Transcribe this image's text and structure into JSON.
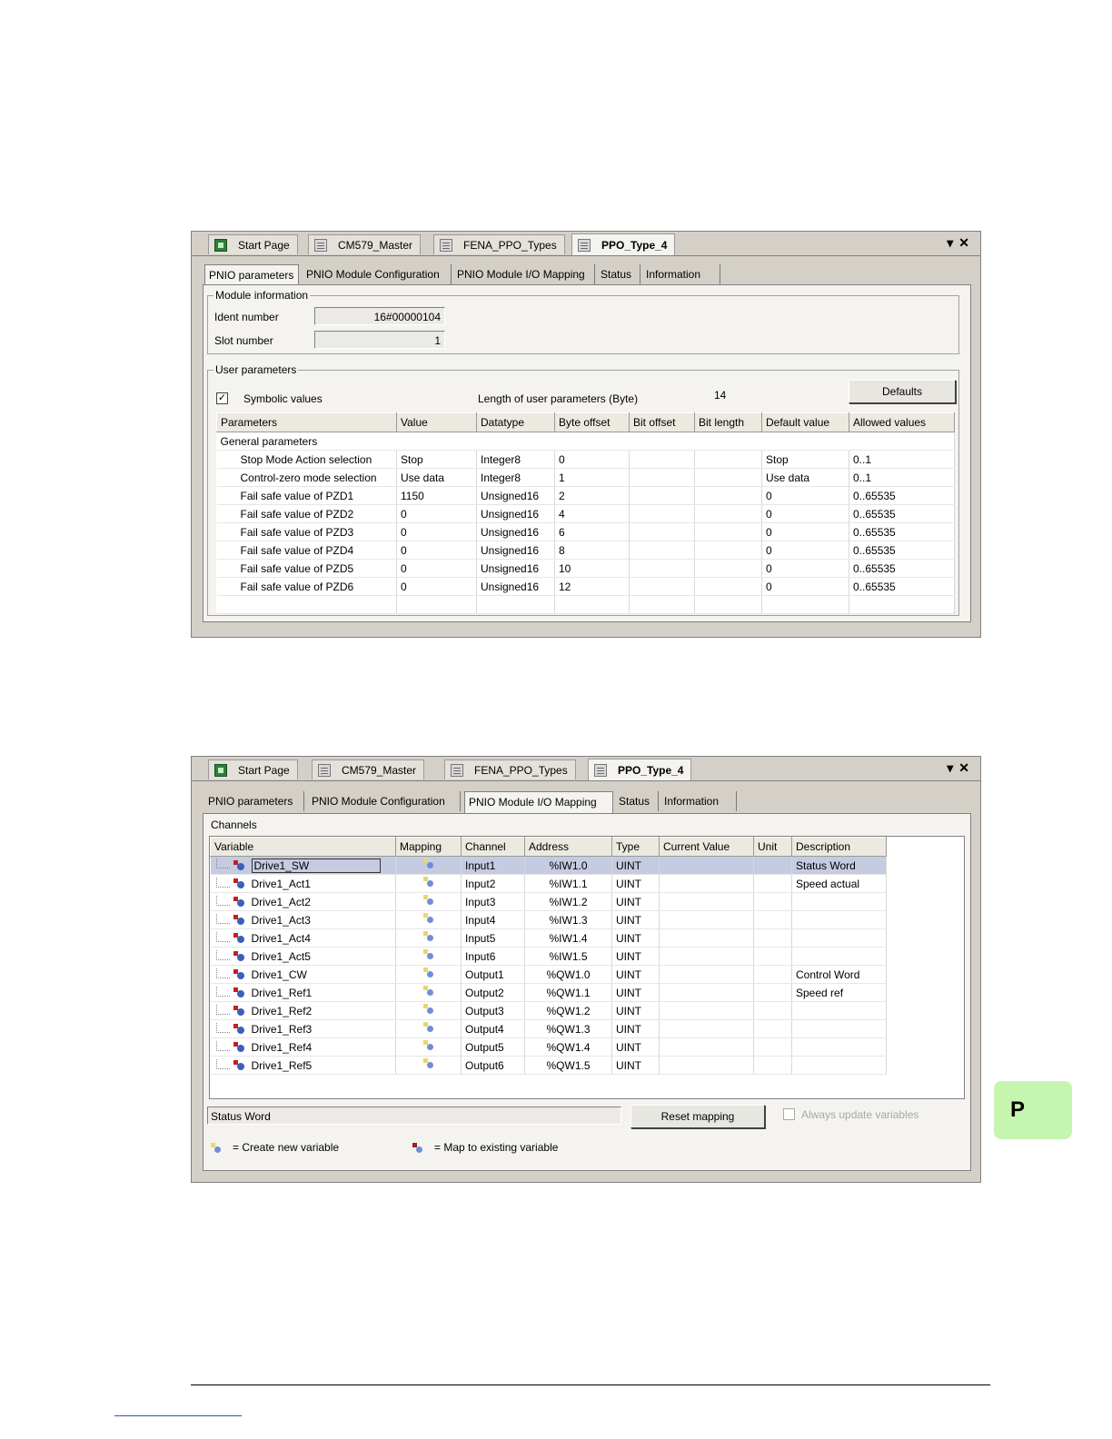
{
  "window1": {
    "doc_tabs": [
      "Start Page",
      "CM579_Master",
      "FENA_PPO_Types",
      "PPO_Type_4"
    ],
    "sub_tabs": [
      "PNIO parameters",
      "PNIO Module Configuration",
      "PNIO Module I/O Mapping",
      "Status",
      "Information"
    ],
    "module_info": {
      "legend": "Module information",
      "ident_label": "Ident number",
      "ident_value": "16#00000104",
      "slot_label": "Slot number",
      "slot_value": "1"
    },
    "user_params": {
      "legend": "User parameters",
      "symbolic_label": "Symbolic values",
      "symbolic_checked": "✓",
      "length_label": "Length of user parameters (Byte)",
      "length_value": "14",
      "defaults_button": "Defaults"
    },
    "table": {
      "headers": [
        "Parameters",
        "Value",
        "Datatype",
        "Byte offset",
        "Bit offset",
        "Bit length",
        "Default value",
        "Allowed values"
      ],
      "group": "General parameters",
      "rows": [
        [
          "Stop Mode Action selection",
          "Stop",
          "Integer8",
          "0",
          "",
          "",
          "Stop",
          "0..1"
        ],
        [
          "Control-zero mode selection",
          "Use data",
          "Integer8",
          "1",
          "",
          "",
          "Use data",
          "0..1"
        ],
        [
          "Fail safe value of PZD1",
          "1150",
          "Unsigned16",
          "2",
          "",
          "",
          "0",
          "0..65535"
        ],
        [
          "Fail safe value of PZD2",
          "0",
          "Unsigned16",
          "4",
          "",
          "",
          "0",
          "0..65535"
        ],
        [
          "Fail safe value of PZD3",
          "0",
          "Unsigned16",
          "6",
          "",
          "",
          "0",
          "0..65535"
        ],
        [
          "Fail safe value of PZD4",
          "0",
          "Unsigned16",
          "8",
          "",
          "",
          "0",
          "0..65535"
        ],
        [
          "Fail safe value of PZD5",
          "0",
          "Unsigned16",
          "10",
          "",
          "",
          "0",
          "0..65535"
        ],
        [
          "Fail safe value of PZD6",
          "0",
          "Unsigned16",
          "12",
          "",
          "",
          "0",
          "0..65535"
        ]
      ]
    }
  },
  "window2": {
    "doc_tabs": [
      "Start Page",
      "CM579_Master",
      "FENA_PPO_Types",
      "PPO_Type_4"
    ],
    "sub_tabs": [
      "PNIO parameters",
      "PNIO Module Configuration",
      "PNIO Module I/O Mapping",
      "Status",
      "Information"
    ],
    "channels_label": "Channels",
    "table": {
      "headers": [
        "Variable",
        "Mapping",
        "Channel",
        "Address",
        "Type",
        "Current Value",
        "Unit",
        "Description"
      ],
      "rows": [
        [
          "Drive1_SW",
          "Input1",
          "%IW1.0",
          "UINT",
          "Status Word"
        ],
        [
          "Drive1_Act1",
          "Input2",
          "%IW1.1",
          "UINT",
          "Speed actual"
        ],
        [
          "Drive1_Act2",
          "Input3",
          "%IW1.2",
          "UINT",
          ""
        ],
        [
          "Drive1_Act3",
          "Input4",
          "%IW1.3",
          "UINT",
          ""
        ],
        [
          "Drive1_Act4",
          "Input5",
          "%IW1.4",
          "UINT",
          ""
        ],
        [
          "Drive1_Act5",
          "Input6",
          "%IW1.5",
          "UINT",
          ""
        ],
        [
          "Drive1_CW",
          "Output1",
          "%QW1.0",
          "UINT",
          "Control Word"
        ],
        [
          "Drive1_Ref1",
          "Output2",
          "%QW1.1",
          "UINT",
          "Speed ref"
        ],
        [
          "Drive1_Ref2",
          "Output3",
          "%QW1.2",
          "UINT",
          ""
        ],
        [
          "Drive1_Ref3",
          "Output4",
          "%QW1.3",
          "UINT",
          ""
        ],
        [
          "Drive1_Ref4",
          "Output5",
          "%QW1.4",
          "UINT",
          ""
        ],
        [
          "Drive1_Ref5",
          "Output6",
          "%QW1.5",
          "UINT",
          ""
        ]
      ]
    },
    "status_field": "Status Word",
    "reset_button": "Reset mapping",
    "always_update_label": "Always update variables",
    "legend_create": "= Create new variable",
    "legend_map": "= Map to existing variable"
  },
  "side_badge": "P"
}
